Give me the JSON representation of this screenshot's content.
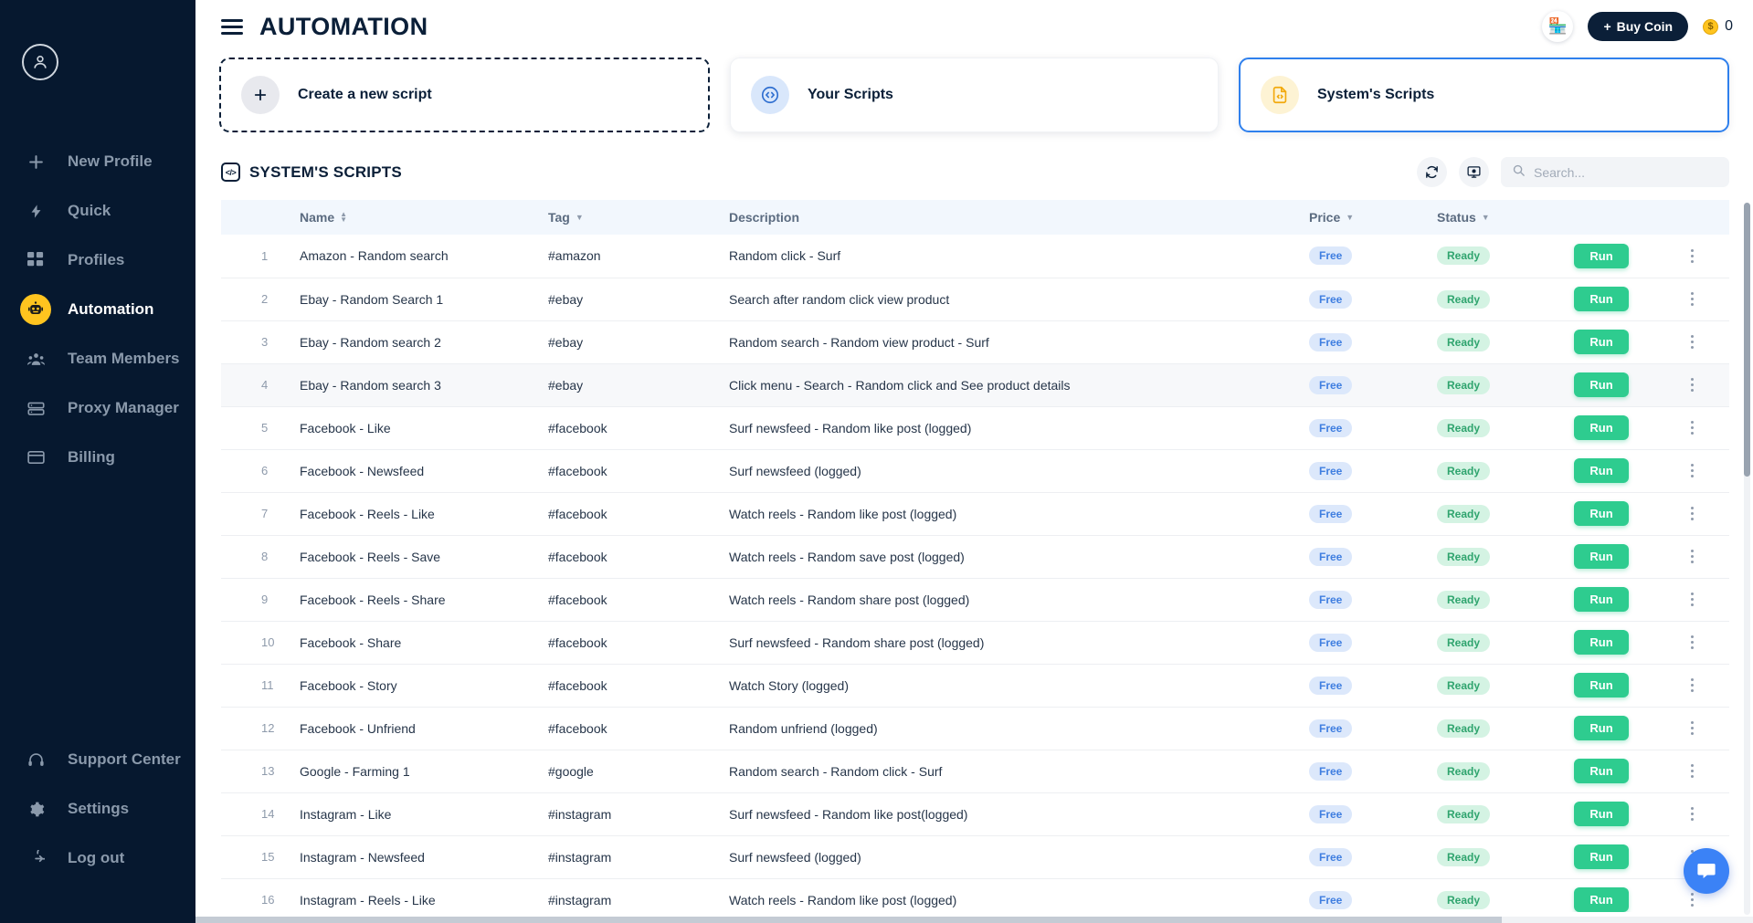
{
  "sidebar": {
    "avatar_icon": "user-avatar-icon",
    "items": [
      {
        "label": "New Profile",
        "icon": "plus-icon",
        "active": false
      },
      {
        "label": "Quick",
        "icon": "lightning-icon",
        "active": false
      },
      {
        "label": "Profiles",
        "icon": "grid-icon",
        "active": false
      },
      {
        "label": "Automation",
        "icon": "robot-icon",
        "active": true
      },
      {
        "label": "Team Members",
        "icon": "team-icon",
        "active": false
      },
      {
        "label": "Proxy Manager",
        "icon": "proxy-server-icon",
        "active": false
      },
      {
        "label": "Billing",
        "icon": "billing-card-icon",
        "active": false
      }
    ],
    "bottom_items": [
      {
        "label": "Support Center",
        "icon": "headset-icon"
      },
      {
        "label": "Settings",
        "icon": "gear-icon"
      },
      {
        "label": "Log out",
        "icon": "logout-icon"
      }
    ]
  },
  "header": {
    "menu_icon": "hamburger-icon",
    "title": "AUTOMATION",
    "store_icon": "store-icon",
    "buy_coin_label": "Buy Coin",
    "buy_coin_plus": "+",
    "coin_icon": "coin-icon",
    "coin_balance": "0"
  },
  "cards": [
    {
      "label": "Create a new script",
      "icon": "plus-icon",
      "style": "dashed",
      "icon_bg": "ci-grey"
    },
    {
      "label": "Your Scripts",
      "icon": "code-circle-icon",
      "style": "plain",
      "icon_bg": "ci-blue"
    },
    {
      "label": "System's Scripts",
      "icon": "system-script-icon",
      "style": "selected",
      "icon_bg": "ci-yellow"
    }
  ],
  "section": {
    "icon": "code-brackets-icon",
    "title": "SYSTEM'S SCRIPTS",
    "refresh_icon": "refresh-icon",
    "display_icon": "monitor-settings-icon",
    "search_placeholder": "Search...",
    "search_value": "",
    "search_icon": "search-icon"
  },
  "table": {
    "columns": [
      {
        "key": "idx",
        "label": "",
        "sort": "none"
      },
      {
        "key": "name",
        "label": "Name",
        "sort": "updown"
      },
      {
        "key": "tag",
        "label": "Tag",
        "sort": "down"
      },
      {
        "key": "desc",
        "label": "Description",
        "sort": "none"
      },
      {
        "key": "price",
        "label": "Price",
        "sort": "down"
      },
      {
        "key": "status",
        "label": "Status",
        "sort": "down"
      },
      {
        "key": "run",
        "label": "",
        "sort": "none"
      },
      {
        "key": "menu",
        "label": "",
        "sort": "none"
      }
    ],
    "run_label": "Run",
    "rows": [
      {
        "idx": "1",
        "name": "Amazon - Random search",
        "tag": "#amazon",
        "desc": "Random click - Surf",
        "price": "Free",
        "status": "Ready",
        "hovered": false
      },
      {
        "idx": "2",
        "name": "Ebay - Random Search 1",
        "tag": "#ebay",
        "desc": "Search after random click view product",
        "price": "Free",
        "status": "Ready",
        "hovered": false
      },
      {
        "idx": "3",
        "name": "Ebay - Random search 2",
        "tag": "#ebay",
        "desc": "Random search - Random view product - Surf",
        "price": "Free",
        "status": "Ready",
        "hovered": false
      },
      {
        "idx": "4",
        "name": "Ebay - Random search 3",
        "tag": "#ebay",
        "desc": "Click menu - Search - Random click and See product details",
        "price": "Free",
        "status": "Ready",
        "hovered": true
      },
      {
        "idx": "5",
        "name": "Facebook - Like",
        "tag": "#facebook",
        "desc": "Surf newsfeed - Random like post (logged)",
        "price": "Free",
        "status": "Ready",
        "hovered": false
      },
      {
        "idx": "6",
        "name": "Facebook - Newsfeed",
        "tag": "#facebook",
        "desc": "Surf newsfeed (logged)",
        "price": "Free",
        "status": "Ready",
        "hovered": false
      },
      {
        "idx": "7",
        "name": "Facebook - Reels - Like",
        "tag": "#facebook",
        "desc": "Watch reels - Random like post (logged)",
        "price": "Free",
        "status": "Ready",
        "hovered": false
      },
      {
        "idx": "8",
        "name": "Facebook - Reels - Save",
        "tag": "#facebook",
        "desc": "Watch reels - Random save post (logged)",
        "price": "Free",
        "status": "Ready",
        "hovered": false
      },
      {
        "idx": "9",
        "name": "Facebook - Reels - Share",
        "tag": "#facebook",
        "desc": "Watch reels - Random share post (logged)",
        "price": "Free",
        "status": "Ready",
        "hovered": false
      },
      {
        "idx": "10",
        "name": "Facebook - Share",
        "tag": "#facebook",
        "desc": "Surf newsfeed - Random share post (logged)",
        "price": "Free",
        "status": "Ready",
        "hovered": false
      },
      {
        "idx": "11",
        "name": "Facebook - Story",
        "tag": "#facebook",
        "desc": "Watch Story (logged)",
        "price": "Free",
        "status": "Ready",
        "hovered": false
      },
      {
        "idx": "12",
        "name": "Facebook - Unfriend",
        "tag": "#facebook",
        "desc": "Random unfriend (logged)",
        "price": "Free",
        "status": "Ready",
        "hovered": false
      },
      {
        "idx": "13",
        "name": "Google - Farming 1",
        "tag": "#google",
        "desc": "Random search - Random click - Surf",
        "price": "Free",
        "status": "Ready",
        "hovered": false
      },
      {
        "idx": "14",
        "name": "Instagram - Like",
        "tag": "#instagram",
        "desc": "Surf newsfeed - Random like post(logged)",
        "price": "Free",
        "status": "Ready",
        "hovered": false
      },
      {
        "idx": "15",
        "name": "Instagram - Newsfeed",
        "tag": "#instagram",
        "desc": "Surf newsfeed (logged)",
        "price": "Free",
        "status": "Ready",
        "hovered": false
      },
      {
        "idx": "16",
        "name": "Instagram - Reels - Like",
        "tag": "#instagram",
        "desc": "Watch reels - Random like post (logged)",
        "price": "Free",
        "status": "Ready",
        "hovered": false
      }
    ]
  },
  "chat": {
    "icon": "chat-bubble-icon"
  },
  "colors": {
    "sidebar_bg": "#06182F",
    "accent_yellow": "#FFC41F",
    "accent_blue": "#2F80ED",
    "run_green": "#2ECC8F",
    "badge_free_bg": "#DCE8FB",
    "badge_free_text": "#3F7EE0",
    "badge_ready_bg": "#D4F3E3",
    "badge_ready_text": "#2FA46E",
    "header_row_bg": "#F2F7FD",
    "dark_text": "#0B1F38"
  }
}
